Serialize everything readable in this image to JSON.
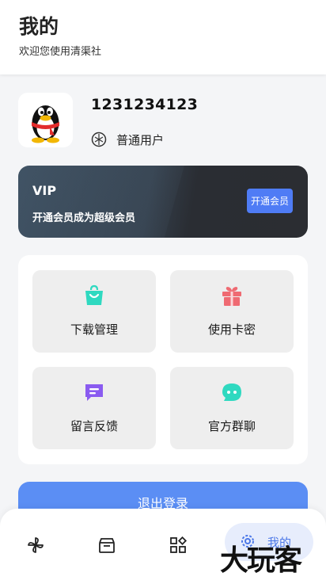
{
  "header": {
    "title": "我的",
    "subtitle": "欢迎您使用清渠社"
  },
  "profile": {
    "avatar_icon": "qq-penguin-avatar",
    "username": "1231234123",
    "level_icon": "level-badge-icon",
    "level": "普通用户"
  },
  "vip": {
    "title": "VIP",
    "description": "开通会员成为超级会员",
    "button_label": "开通会员",
    "button_color": "#4f7cf5"
  },
  "menu": {
    "items": [
      {
        "label": "下载管理",
        "icon": "shopping-bag-icon",
        "color": "#2fd9c0"
      },
      {
        "label": "使用卡密",
        "icon": "gift-icon",
        "color": "#ef6a72"
      },
      {
        "label": "留言反馈",
        "icon": "message-icon",
        "color": "#8a5bf0"
      },
      {
        "label": "官方群聊",
        "icon": "chat-bubble-icon",
        "color": "#2fd9c0"
      }
    ]
  },
  "logout": {
    "label": "退出登录"
  },
  "bottom_nav": {
    "items": [
      {
        "icon": "pinwheel-icon"
      },
      {
        "icon": "store-icon"
      },
      {
        "icon": "apps-icon"
      },
      {
        "icon": "gear-icon",
        "label": "我的",
        "active": true
      }
    ],
    "accent": "#4c78e8"
  },
  "watermark": {
    "text": "大玩客"
  }
}
